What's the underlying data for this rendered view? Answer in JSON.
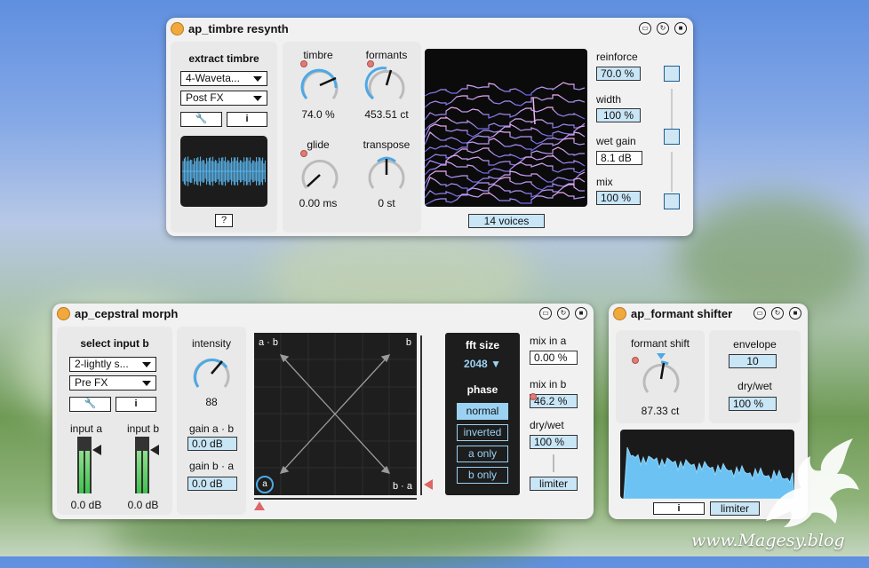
{
  "timbre_resynth": {
    "title": "ap_timbre resynth",
    "extract_label": "extract timbre",
    "source_select": "4-Waveta...",
    "tap_select": "Post FX",
    "help_label": "?",
    "info_label": "i",
    "timbre": {
      "label": "timbre",
      "value": "74.0 %"
    },
    "formants": {
      "label": "formants",
      "value": "453.51 ct"
    },
    "glide": {
      "label": "glide",
      "value": "0.00 ms"
    },
    "transpose": {
      "label": "transpose",
      "value": "0 st"
    },
    "voices": "14 voices",
    "reinforce": {
      "label": "reinforce",
      "value": "70.0 %"
    },
    "width": {
      "label": "width",
      "value": "100 %"
    },
    "wet_gain": {
      "label": "wet gain",
      "value": "8.1 dB"
    },
    "mix": {
      "label": "mix",
      "value": "100 %"
    }
  },
  "cepstral_morph": {
    "title": "ap_cepstral morph",
    "select_label": "select input b",
    "source_select": "2-lightly s...",
    "tap_select": "Pre FX",
    "info_label": "i",
    "input_a": {
      "label": "input a",
      "value": "0.0 dB"
    },
    "input_b": {
      "label": "input b",
      "value": "0.0 dB"
    },
    "intensity": {
      "label": "intensity",
      "value": "88"
    },
    "gain_ab": {
      "label": "gain a · b",
      "value": "0.0 dB"
    },
    "gain_ba": {
      "label": "gain b · a",
      "value": "0.0 dB"
    },
    "xy": {
      "tl": "a · b",
      "tr": "b",
      "bl": "a",
      "br": "b · a"
    },
    "fft_label": "fft size",
    "fft_value": "2048",
    "phase_label": "phase",
    "phase_options": [
      "normal",
      "inverted",
      "a only",
      "b only"
    ],
    "phase_selected": 0,
    "mix_in_a": {
      "label": "mix in a",
      "value": "0.00 %"
    },
    "mix_in_b": {
      "label": "mix in b",
      "value": "46.2 %"
    },
    "dry_wet": {
      "label": "dry/wet",
      "value": "100 %"
    },
    "limiter": "limiter"
  },
  "formant_shifter": {
    "title": "ap_formant shifter",
    "formant_shift": {
      "label": "formant shift",
      "value": "87.33 ct"
    },
    "envelope": {
      "label": "envelope",
      "value": "10"
    },
    "dry_wet": {
      "label": "dry/wet",
      "value": "100 %"
    },
    "info_label": "i",
    "limiter": "limiter"
  },
  "watermark": "www.Magesy.blog"
}
